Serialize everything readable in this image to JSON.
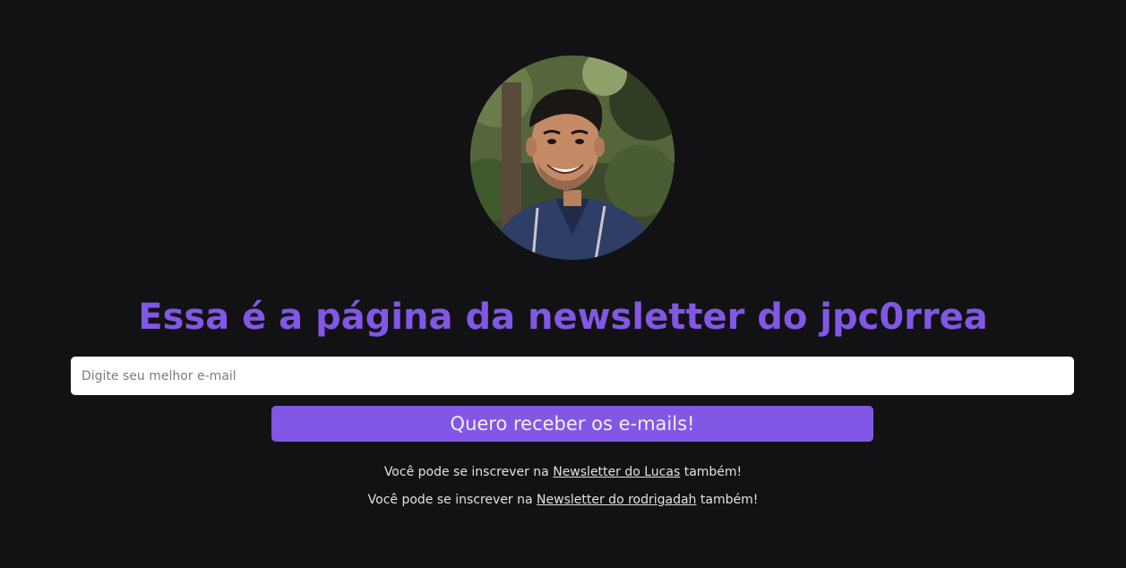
{
  "profile": {
    "avatar_icon": "profile-photo"
  },
  "heading": {
    "title": "Essa é a página da newsletter do jpc0rrea"
  },
  "form": {
    "email_placeholder": "Digite seu melhor e-mail",
    "email_value": "",
    "submit_label": "Quero receber os e-mails!"
  },
  "links": [
    {
      "prefix": "Você pode se inscrever na",
      "link_text": "Newsletter do Lucas",
      "suffix": "também!"
    },
    {
      "prefix": "Você pode se inscrever na",
      "link_text": "Newsletter do rodrigadah",
      "suffix": "também!"
    }
  ],
  "colors": {
    "background": "#121214",
    "accent": "#8257e5",
    "text": "#e1e1e6"
  }
}
